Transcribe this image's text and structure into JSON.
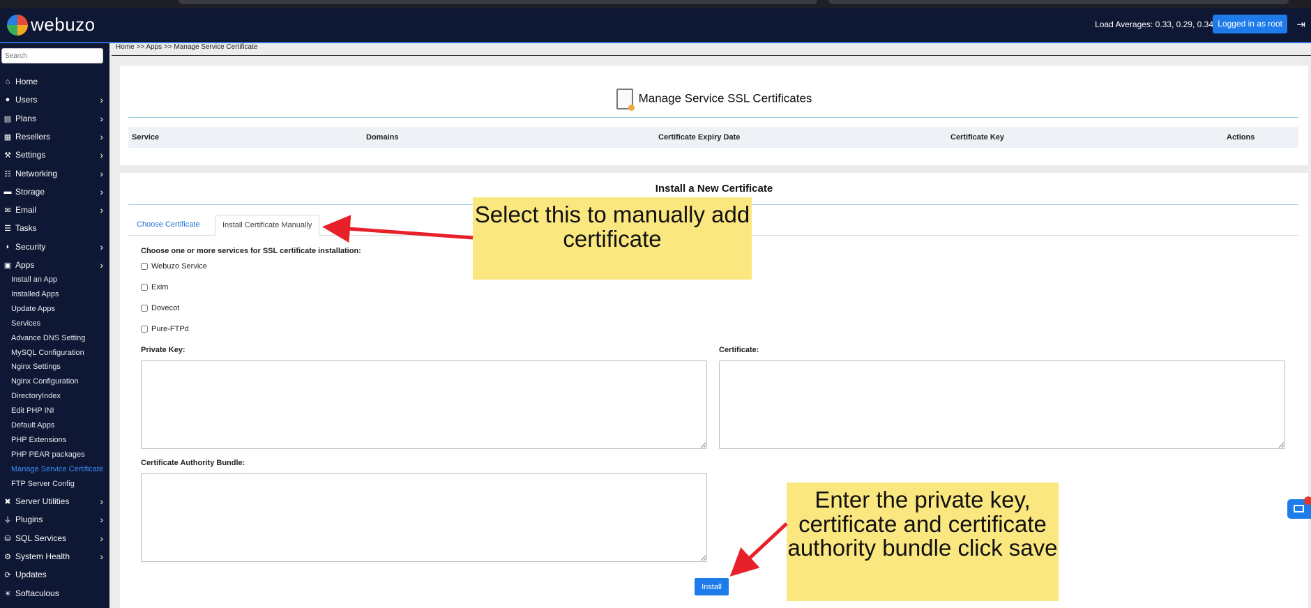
{
  "app": {
    "brand": "webuzo"
  },
  "header": {
    "load_averages": "Load Averages: 0.33, 0.29, 0.34",
    "logged_in": "Logged in as root"
  },
  "sidebar": {
    "search_placeholder": "Search",
    "items": [
      {
        "label": "Home",
        "icon": "home-icon",
        "chevron": false
      },
      {
        "label": "Users",
        "icon": "user-icon",
        "chevron": true
      },
      {
        "label": "Plans",
        "icon": "plans-icon",
        "chevron": true
      },
      {
        "label": "Resellers",
        "icon": "resellers-icon",
        "chevron": true
      },
      {
        "label": "Settings",
        "icon": "wrench-icon",
        "chevron": true
      },
      {
        "label": "Networking",
        "icon": "network-icon",
        "chevron": true
      },
      {
        "label": "Storage",
        "icon": "storage-icon",
        "chevron": true
      },
      {
        "label": "Email",
        "icon": "envelope-icon",
        "chevron": true
      },
      {
        "label": "Tasks",
        "icon": "list-icon",
        "chevron": false
      },
      {
        "label": "Security",
        "icon": "shield-icon",
        "chevron": true
      },
      {
        "label": "Apps",
        "icon": "apps-icon",
        "chevron": true
      }
    ],
    "apps_sub": [
      "Install an App",
      "Installed Apps",
      "Update Apps",
      "Services",
      "Advance DNS Setting",
      "MySQL Configuration",
      "Nginx Settings",
      "Nginx Configuration",
      "DirectoryIndex",
      "Edit PHP INI",
      "Default Apps",
      "PHP Extensions",
      "PHP PEAR packages",
      "Manage Service Certificate",
      "FTP Server Config"
    ],
    "apps_active": "Manage Service Certificate",
    "items_after": [
      {
        "label": "Server Utilities",
        "icon": "tools-icon",
        "chevron": true
      },
      {
        "label": "Plugins",
        "icon": "plug-icon",
        "chevron": true
      },
      {
        "label": "SQL Services",
        "icon": "database-icon",
        "chevron": true
      },
      {
        "label": "System Health",
        "icon": "health-icon",
        "chevron": true
      },
      {
        "label": "Updates",
        "icon": "refresh-icon",
        "chevron": false
      },
      {
        "label": "Softaculous",
        "icon": "softaculous-icon",
        "chevron": false
      }
    ]
  },
  "breadcrumb": "Home >> Apps >> Manage Service Certificate",
  "certs_table": {
    "title": "Manage Service SSL Certificates",
    "columns": [
      "Service",
      "Domains",
      "Certificate Expiry Date",
      "Certificate Key",
      "Actions"
    ]
  },
  "install": {
    "title": "Install a New Certificate",
    "tabs": [
      "Choose Certificate",
      "Install Certificate Manually"
    ],
    "active_tab": "Install Certificate Manually",
    "choose_label": "Choose one or more services for SSL certificate installation:",
    "services": [
      "Webuzo Service",
      "Exim",
      "Dovecot",
      "Pure-FTPd"
    ],
    "private_key_label": "Private Key:",
    "certificate_label": "Certificate:",
    "ca_bundle_label": "Certificate Authority Bundle:",
    "install_button": "Install"
  },
  "callouts": {
    "tab_note": "Select this to manually add certificate",
    "install_note": "Enter the private key, certificate and certificate authority bundle click save"
  },
  "colors": {
    "navbar": "#0e1733",
    "accent": "#1d7bea",
    "callout": "#fbe77f",
    "arrow": "#e8202a"
  }
}
